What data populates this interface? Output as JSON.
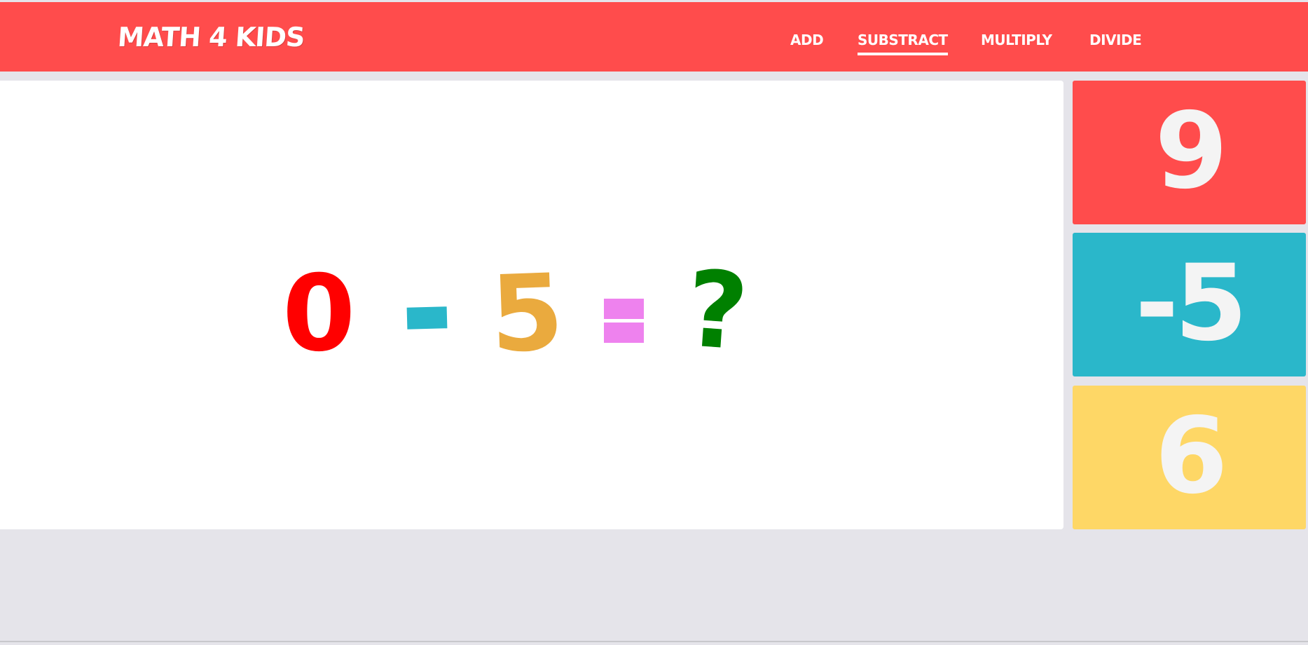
{
  "header": {
    "logo": "MATH 4 KIDS",
    "nav": [
      {
        "label": "ADD",
        "active": false
      },
      {
        "label": "SUBSTRACT",
        "active": true
      },
      {
        "label": "MULTIPLY",
        "active": false
      },
      {
        "label": "DIVIDE",
        "active": false
      }
    ]
  },
  "problem": {
    "operand_a": "0",
    "operand_b": "5",
    "unknown": "?",
    "colors": {
      "operand_a": "#ff0000",
      "operator": "#2ab7ca",
      "operand_b": "#eaaa3e",
      "equals": "#ee82ee",
      "unknown": "#008000"
    }
  },
  "answers": [
    {
      "value": "9",
      "color": "#ff4c4c"
    },
    {
      "value": "-5",
      "color": "#2ab7ca"
    },
    {
      "value": "6",
      "color": "#fed766"
    }
  ],
  "colors": {
    "header_bg": "#ff4c4c",
    "page_bg": "#e5e4ea",
    "panel_bg": "#ffffff"
  }
}
